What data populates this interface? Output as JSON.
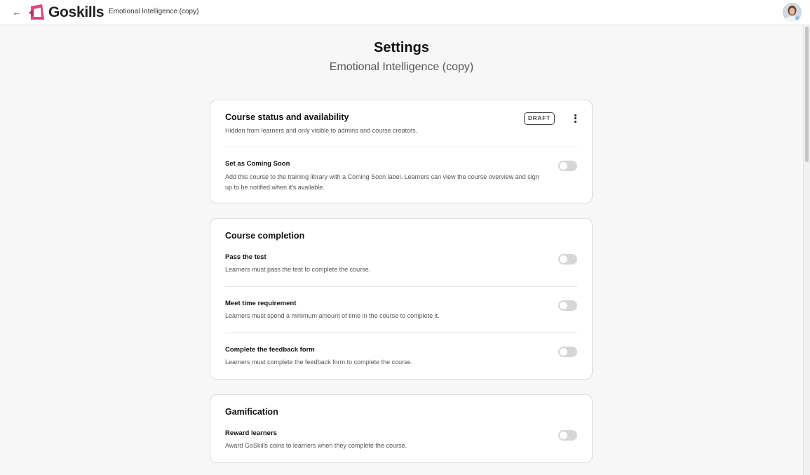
{
  "header": {
    "back_label": "←",
    "brand": "Goskills",
    "course_name": "Emotional Intelligence (copy)"
  },
  "page": {
    "title": "Settings",
    "subtitle": "Emotional Intelligence (copy)"
  },
  "status_card": {
    "title": "Course status and availability",
    "description": "Hidden from learners and only visible to admins and course creators.",
    "badge": "DRAFT",
    "coming_soon": {
      "title": "Set as Coming Soon",
      "description": "Add this course to the training library with a Coming Soon label. Learners can view the course overview and sign up to be notified when it's available.",
      "enabled": false
    }
  },
  "completion_card": {
    "title": "Course completion",
    "items": [
      {
        "title": "Pass the test",
        "description": "Learners must pass the test to complete the course.",
        "enabled": false
      },
      {
        "title": "Meet time requirement",
        "description": "Learners must spend a minimum amount of time in the course to complete it.",
        "enabled": false
      },
      {
        "title": "Complete the feedback form",
        "description": "Learners must complete the feedback form to complete the course.",
        "enabled": false
      }
    ]
  },
  "gamification_card": {
    "title": "Gamification",
    "reward": {
      "title": "Reward learners",
      "description": "Award GoSkills coins to learners when they complete the course.",
      "enabled": false
    }
  },
  "colors": {
    "brand": "#e0457b",
    "toggle_off": "#d6d6d6",
    "background": "#f7f7f7"
  }
}
